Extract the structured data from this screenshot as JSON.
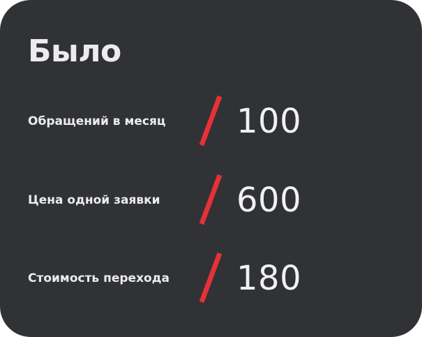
{
  "card": {
    "title": "Было",
    "accent_color": "#e63136",
    "rows": [
      {
        "label": "Обращений в месяц",
        "value": "100"
      },
      {
        "label": "Цена одной заявки",
        "value": "600"
      },
      {
        "label": "Стоимость перехода",
        "value": "180"
      }
    ]
  }
}
